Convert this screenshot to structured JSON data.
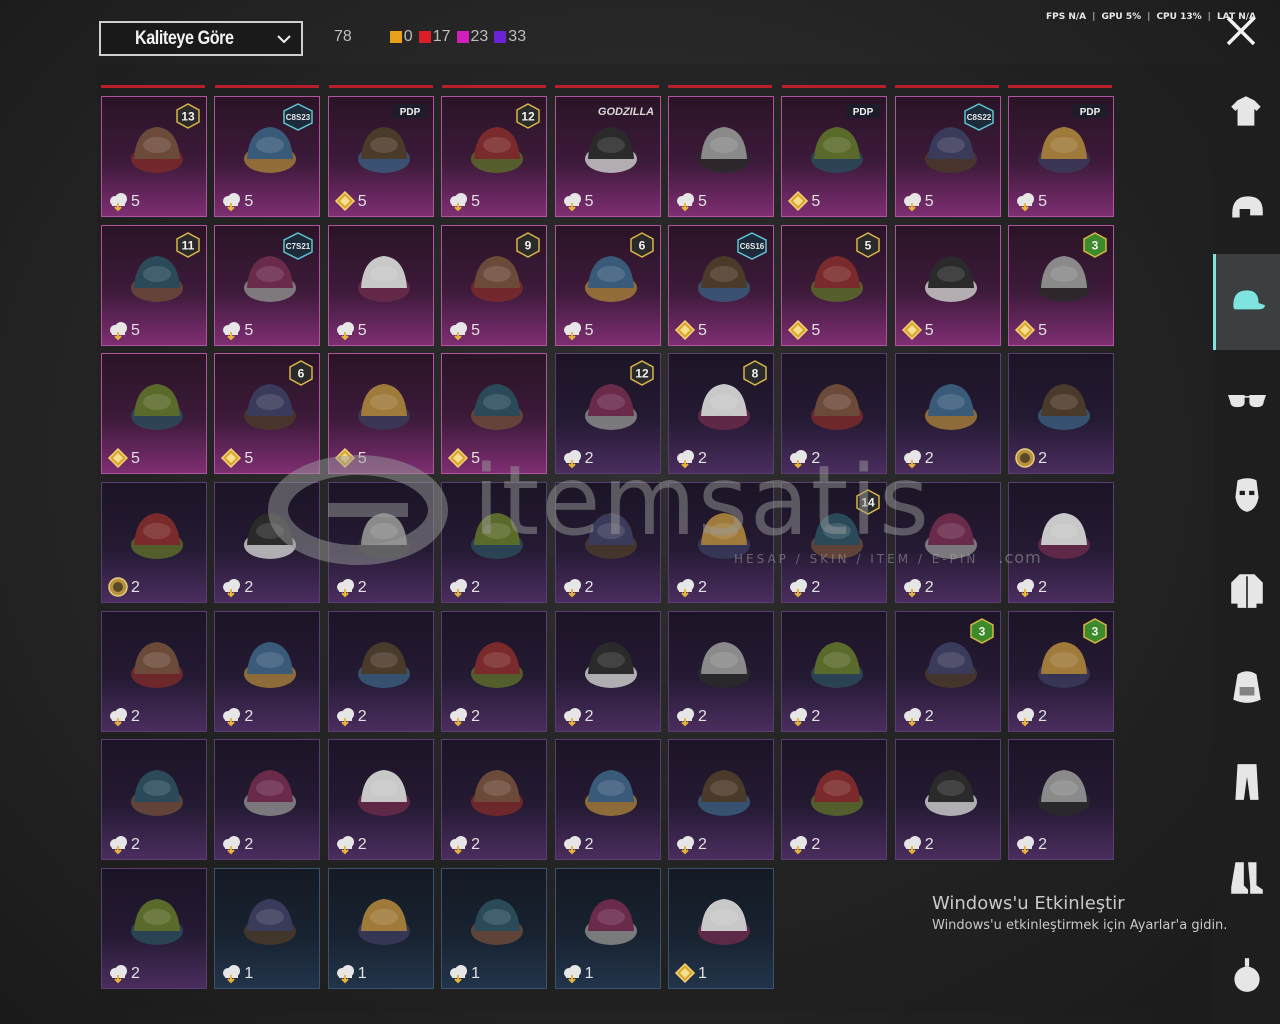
{
  "toolbar": {
    "sort_label": "Kaliteye Göre",
    "total_count": "78",
    "rarity_counts": [
      {
        "color": "#e8a019",
        "count": "0"
      },
      {
        "color": "#d91e27",
        "count": "17"
      },
      {
        "color": "#d21eb8",
        "count": "23"
      },
      {
        "color": "#6a23d6",
        "count": "33"
      }
    ]
  },
  "stats": {
    "fps": "FPS N/A",
    "gpu": "GPU 5%",
    "cpu": "CPU 13%",
    "lat": "LAT N/A"
  },
  "watermark": {
    "text": "itemsatis",
    "sub": "HESAP / SKIN / ITEM / E-PIN",
    "com": ".com"
  },
  "windows_notice": {
    "title": "Windows'u Etkinleştir",
    "subtitle": "Windows'u etkinleştirmek için Ayarlar'a gidin."
  },
  "colors": {
    "accent": "#7fe3e0",
    "high_purple": "#7e2e72",
    "low_purple": "#4a2d5e",
    "blue_tier": "#22344a"
  },
  "sidebar": {
    "items": [
      {
        "icon": "outfit-icon"
      },
      {
        "icon": "helmet-icon"
      },
      {
        "icon": "cap-icon",
        "active": true
      },
      {
        "icon": "glasses-icon"
      },
      {
        "icon": "mask-icon"
      },
      {
        "icon": "jacket-icon"
      },
      {
        "icon": "backpack-icon"
      },
      {
        "icon": "pants-icon"
      },
      {
        "icon": "shoes-icon"
      },
      {
        "icon": "emblem-icon"
      }
    ]
  },
  "items": [
    {
      "tier": "p-high",
      "cur": "cloud",
      "qty": "5",
      "badge": "13",
      "art": "goggle-helmet"
    },
    {
      "tier": "p-high",
      "cur": "cloud",
      "qty": "5",
      "badge": "C8S23",
      "art": "cat-headphones"
    },
    {
      "tier": "p-high",
      "cur": "diamond",
      "qty": "5",
      "badge": "PDP",
      "art": "cap"
    },
    {
      "tier": "p-high",
      "cur": "cloud",
      "qty": "5",
      "badge": "12",
      "art": "wild-hair"
    },
    {
      "tier": "p-high",
      "cur": "cloud",
      "qty": "5",
      "badge": "GODZILLA",
      "art": "spiky-hair"
    },
    {
      "tier": "p-high",
      "cur": "cloud",
      "qty": "5",
      "badge": "",
      "art": "red-hair"
    },
    {
      "tier": "p-high",
      "cur": "diamond",
      "qty": "5",
      "badge": "PDP",
      "art": "animal-mask"
    },
    {
      "tier": "p-high",
      "cur": "cloud",
      "qty": "5",
      "badge": "C8S22",
      "art": "bob-hair"
    },
    {
      "tier": "p-high",
      "cur": "cloud",
      "qty": "5",
      "badge": "PDP",
      "art": "panda"
    },
    {
      "tier": "p-high",
      "cur": "cloud",
      "qty": "5",
      "badge": "11",
      "art": "flower-hair"
    },
    {
      "tier": "p-high",
      "cur": "cloud",
      "qty": "5",
      "badge": "C7S21",
      "art": "silver-hair"
    },
    {
      "tier": "p-high",
      "cur": "cloud",
      "qty": "5",
      "badge": "",
      "art": "pumpkin"
    },
    {
      "tier": "p-high",
      "cur": "cloud",
      "qty": "5",
      "badge": "9",
      "art": "dark-hair"
    },
    {
      "tier": "p-high",
      "cur": "cloud",
      "qty": "5",
      "badge": "6",
      "art": "horned-helm"
    },
    {
      "tier": "p-high",
      "cur": "diamond",
      "qty": "5",
      "badge": "C6S16",
      "art": "crimson-hair"
    },
    {
      "tier": "p-high",
      "cur": "diamond",
      "qty": "5",
      "badge": "5",
      "art": "bow-hair"
    },
    {
      "tier": "p-high",
      "cur": "diamond",
      "qty": "5",
      "badge": "",
      "art": "white-braids"
    },
    {
      "tier": "p-high",
      "cur": "diamond",
      "qty": "5",
      "badge": "3",
      "art": "jester"
    },
    {
      "tier": "p-high",
      "cur": "diamond",
      "qty": "5",
      "badge": "",
      "art": "bucket-hat"
    },
    {
      "tier": "p-high",
      "cur": "diamond",
      "qty": "5",
      "badge": "6",
      "art": "cyan-crown"
    },
    {
      "tier": "p-high",
      "cur": "diamond",
      "qty": "5",
      "badge": "",
      "art": "red-top-hat"
    },
    {
      "tier": "p-high",
      "cur": "diamond",
      "qty": "5",
      "badge": "",
      "art": "skull-mask"
    },
    {
      "tier": "p-low",
      "cur": "cloud",
      "qty": "2",
      "badge": "12",
      "art": "bunny-ears"
    },
    {
      "tier": "p-low",
      "cur": "cloud",
      "qty": "2",
      "badge": "8",
      "art": "green-skull"
    },
    {
      "tier": "p-low",
      "cur": "cloud",
      "qty": "2",
      "badge": "",
      "art": "blue-cap"
    },
    {
      "tier": "p-low",
      "cur": "cloud",
      "qty": "2",
      "badge": "",
      "art": "gasmask"
    },
    {
      "tier": "p-low",
      "cur": "coin",
      "qty": "2",
      "badge": "",
      "art": "aviator"
    },
    {
      "tier": "p-low",
      "cur": "coin",
      "qty": "2",
      "badge": "",
      "art": "sun-hat"
    },
    {
      "tier": "p-low",
      "cur": "cloud",
      "qty": "2",
      "badge": "",
      "art": "witch-hat"
    },
    {
      "tier": "p-low",
      "cur": "cloud",
      "qty": "2",
      "badge": "",
      "art": "green-cap"
    },
    {
      "tier": "p-low",
      "cur": "cloud",
      "qty": "2",
      "badge": "",
      "art": "pink-braids"
    },
    {
      "tier": "p-low",
      "cur": "cloud",
      "qty": "2",
      "badge": "",
      "art": "dread-mask"
    },
    {
      "tier": "p-low",
      "cur": "cloud",
      "qty": "2",
      "badge": "",
      "art": "magician-hat"
    },
    {
      "tier": "p-low",
      "cur": "cloud",
      "qty": "2",
      "badge": "14",
      "art": "police-cap"
    },
    {
      "tier": "p-low",
      "cur": "cloud",
      "qty": "2",
      "badge": "",
      "art": "pink-cap"
    },
    {
      "tier": "p-low",
      "cur": "cloud",
      "qty": "2",
      "badge": "",
      "art": "black-cap"
    },
    {
      "tier": "p-low",
      "cur": "cloud",
      "qty": "2",
      "badge": "",
      "art": "dark-cap"
    },
    {
      "tier": "p-low",
      "cur": "cloud",
      "qty": "2",
      "badge": "",
      "art": "scarecrow-hat"
    },
    {
      "tier": "p-low",
      "cur": "cloud",
      "qty": "2",
      "badge": "",
      "art": "black-mask"
    },
    {
      "tier": "p-low",
      "cur": "cloud",
      "qty": "2",
      "badge": "",
      "art": "shark-hat"
    },
    {
      "tier": "p-low",
      "cur": "cloud",
      "qty": "2",
      "badge": "",
      "art": "beret-red"
    },
    {
      "tier": "p-low",
      "cur": "cloud",
      "qty": "2",
      "badge": "",
      "art": "red-fedora"
    },
    {
      "tier": "p-low",
      "cur": "cloud",
      "qty": "2",
      "badge": "",
      "art": "grey-shark"
    },
    {
      "tier": "p-low",
      "cur": "cloud",
      "qty": "2",
      "badge": "3",
      "art": "dark-fedora"
    },
    {
      "tier": "p-low",
      "cur": "cloud",
      "qty": "2",
      "badge": "3",
      "art": "flower-crown"
    },
    {
      "tier": "p-low",
      "cur": "cloud",
      "qty": "2",
      "badge": "",
      "art": "cake-hat"
    },
    {
      "tier": "p-low",
      "cur": "cloud",
      "qty": "2",
      "badge": "",
      "art": "burger-hat"
    },
    {
      "tier": "p-low",
      "cur": "cloud",
      "qty": "2",
      "badge": "",
      "art": "headlamp"
    },
    {
      "tier": "p-low",
      "cur": "cloud",
      "qty": "2",
      "badge": "",
      "art": "navy-cap"
    },
    {
      "tier": "p-low",
      "cur": "cloud",
      "qty": "2",
      "badge": "",
      "art": "yellow-logo-cap"
    },
    {
      "tier": "p-low",
      "cur": "cloud",
      "qty": "2",
      "badge": "",
      "art": "blue-cap-2"
    },
    {
      "tier": "p-low",
      "cur": "cloud",
      "qty": "2",
      "badge": "",
      "art": "brown-fedora"
    },
    {
      "tier": "p-low",
      "cur": "cloud",
      "qty": "2",
      "badge": "",
      "art": "bandana"
    },
    {
      "tier": "p-low",
      "cur": "cloud",
      "qty": "2",
      "badge": "",
      "art": "bucket-dark"
    },
    {
      "tier": "p-low",
      "cur": "cloud",
      "qty": "2",
      "badge": "",
      "art": "pilot-cap"
    },
    {
      "tier": "blue",
      "cur": "cloud",
      "qty": "1",
      "badge": "",
      "art": "blue-beret"
    },
    {
      "tier": "blue",
      "cur": "cloud",
      "qty": "1",
      "badge": "",
      "art": "flat-cap"
    },
    {
      "tier": "blue",
      "cur": "cloud",
      "qty": "1",
      "badge": "",
      "art": "trucker-cap"
    },
    {
      "tier": "blue",
      "cur": "cloud",
      "qty": "1",
      "badge": "",
      "art": "trucker-cap-2"
    },
    {
      "tier": "blue",
      "cur": "diamond",
      "qty": "1",
      "badge": "",
      "art": "camo-cap"
    }
  ]
}
